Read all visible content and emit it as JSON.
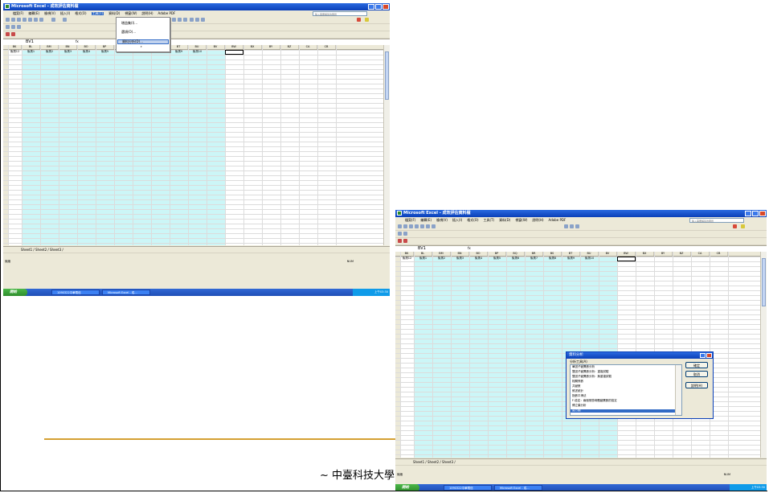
{
  "screenshot1": {
    "window_title": "Microsoft Excel - 成效評估資料檔",
    "menu": [
      "檔案(F)",
      "編輯(E)",
      "檢視(V)",
      "插入(I)",
      "格式(O)",
      "工具(T)",
      "資料(D)",
      "視窗(W)",
      "說明(H)",
      "Adobe PDF"
    ],
    "active_menu_index": 5,
    "help_placeholder": "輸入需要解答的問題",
    "name_box": "BV1",
    "fx": "fx",
    "col_headers": [
      "BK",
      "BL",
      "BM",
      "BN",
      "BO",
      "BP",
      "BQ",
      "BR",
      "BS",
      "BT",
      "BU",
      "BV",
      "BW",
      "BX",
      "BY",
      "BZ",
      "CA",
      "CB"
    ],
    "header_row": [
      "後測12",
      "後測1",
      "後測2",
      "後測3",
      "後測4",
      "後測5",
      "後測6",
      "後測7",
      "後測8",
      "後測9",
      "後測10"
    ],
    "dropdown_items": [
      "增益集(I)...",
      "選項(O)...",
      "資料分析(D)..."
    ],
    "dropdown_highlight_index": 2,
    "sheet_tabs": "Sheet1 / Sheet2 / Sheet3 /",
    "status_left": "就緒",
    "status_right": "NUM",
    "start": "開始",
    "taskbar_items": [
      "1090322中華電信",
      "Microsoft Excel - 成..."
    ],
    "clock": "上午03:30"
  },
  "screenshot2": {
    "window_title": "Microsoft Excel - 成效評估資料檔",
    "menu": [
      "檔案(F)",
      "編輯(E)",
      "檢視(V)",
      "插入(I)",
      "格式(O)",
      "工具(T)",
      "資料(D)",
      "視窗(W)",
      "說明(H)",
      "Adobe PDF"
    ],
    "help_placeholder": "輸入需要解答的問題",
    "name_box": "BV1",
    "fx": "fx",
    "col_headers": [
      "BK",
      "BL",
      "BM",
      "BN",
      "BO",
      "BP",
      "BQ",
      "BR",
      "BS",
      "BT",
      "BU",
      "BV",
      "BW",
      "BX",
      "BY",
      "BZ",
      "CA",
      "CB"
    ],
    "header_row": [
      "後測12",
      "後測1",
      "後測2",
      "後測3",
      "後測4",
      "後測5",
      "後測6",
      "後測7",
      "後測8",
      "後測9",
      "後測10"
    ],
    "dialog": {
      "title": "資料分析",
      "list_label": "分析工具(A)",
      "items": [
        "單因子變異數分析",
        "雙因子變異數分析：重複試驗",
        "雙因子變異數分析：無重複試驗",
        "相關係數",
        "共變數",
        "敘述統計",
        "指數平滑法",
        "F-檢定：兩個常態母體變異數的檢定",
        "傅立葉分析",
        "直方圖"
      ],
      "selected_index": 9,
      "ok": "確定",
      "cancel": "取消",
      "help": "說明(H)"
    },
    "sheet_tabs": "Sheet1 / Sheet2 / Sheet3 /",
    "status_left": "就緒",
    "status_right": "NUM",
    "start": "開始",
    "taskbar_items": [
      "1090322中華電信",
      "Microsoft Excel - 成..."
    ],
    "clock": "上午03:30"
  },
  "footer": "~ 中臺科技大學",
  "colors": {
    "accent_line": "#d4a032",
    "data_fill": "#ccf6f7",
    "titlebar": "#0a3fb8"
  }
}
